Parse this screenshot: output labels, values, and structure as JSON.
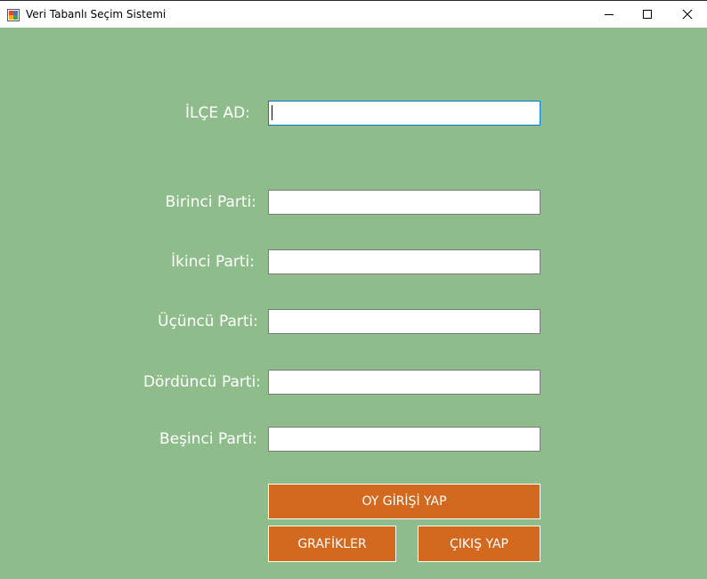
{
  "window": {
    "title": "Veri Tabanlı Seçim Sistemi"
  },
  "form": {
    "ilce": {
      "label": "İLÇE AD:",
      "value": ""
    },
    "parties": [
      {
        "label": "Birinci Parti:",
        "value": ""
      },
      {
        "label": "İkinci Parti:",
        "value": ""
      },
      {
        "label": "Üçüncü Parti:",
        "value": ""
      },
      {
        "label": "Dördüncü Parti:",
        "value": ""
      },
      {
        "label": "Beşinci Parti:",
        "value": ""
      }
    ]
  },
  "buttons": {
    "vote_entry": "OY GİRİŞİ YAP",
    "charts": "GRAFİKLER",
    "exit": "ÇIKIŞ YAP"
  },
  "icons": {
    "app": "app-icon",
    "minimize": "minimize-icon",
    "maximize": "maximize-icon",
    "close": "close-icon"
  },
  "colors": {
    "background": "#8fbc8b",
    "button": "#d2691e",
    "text": "#ffffff"
  }
}
